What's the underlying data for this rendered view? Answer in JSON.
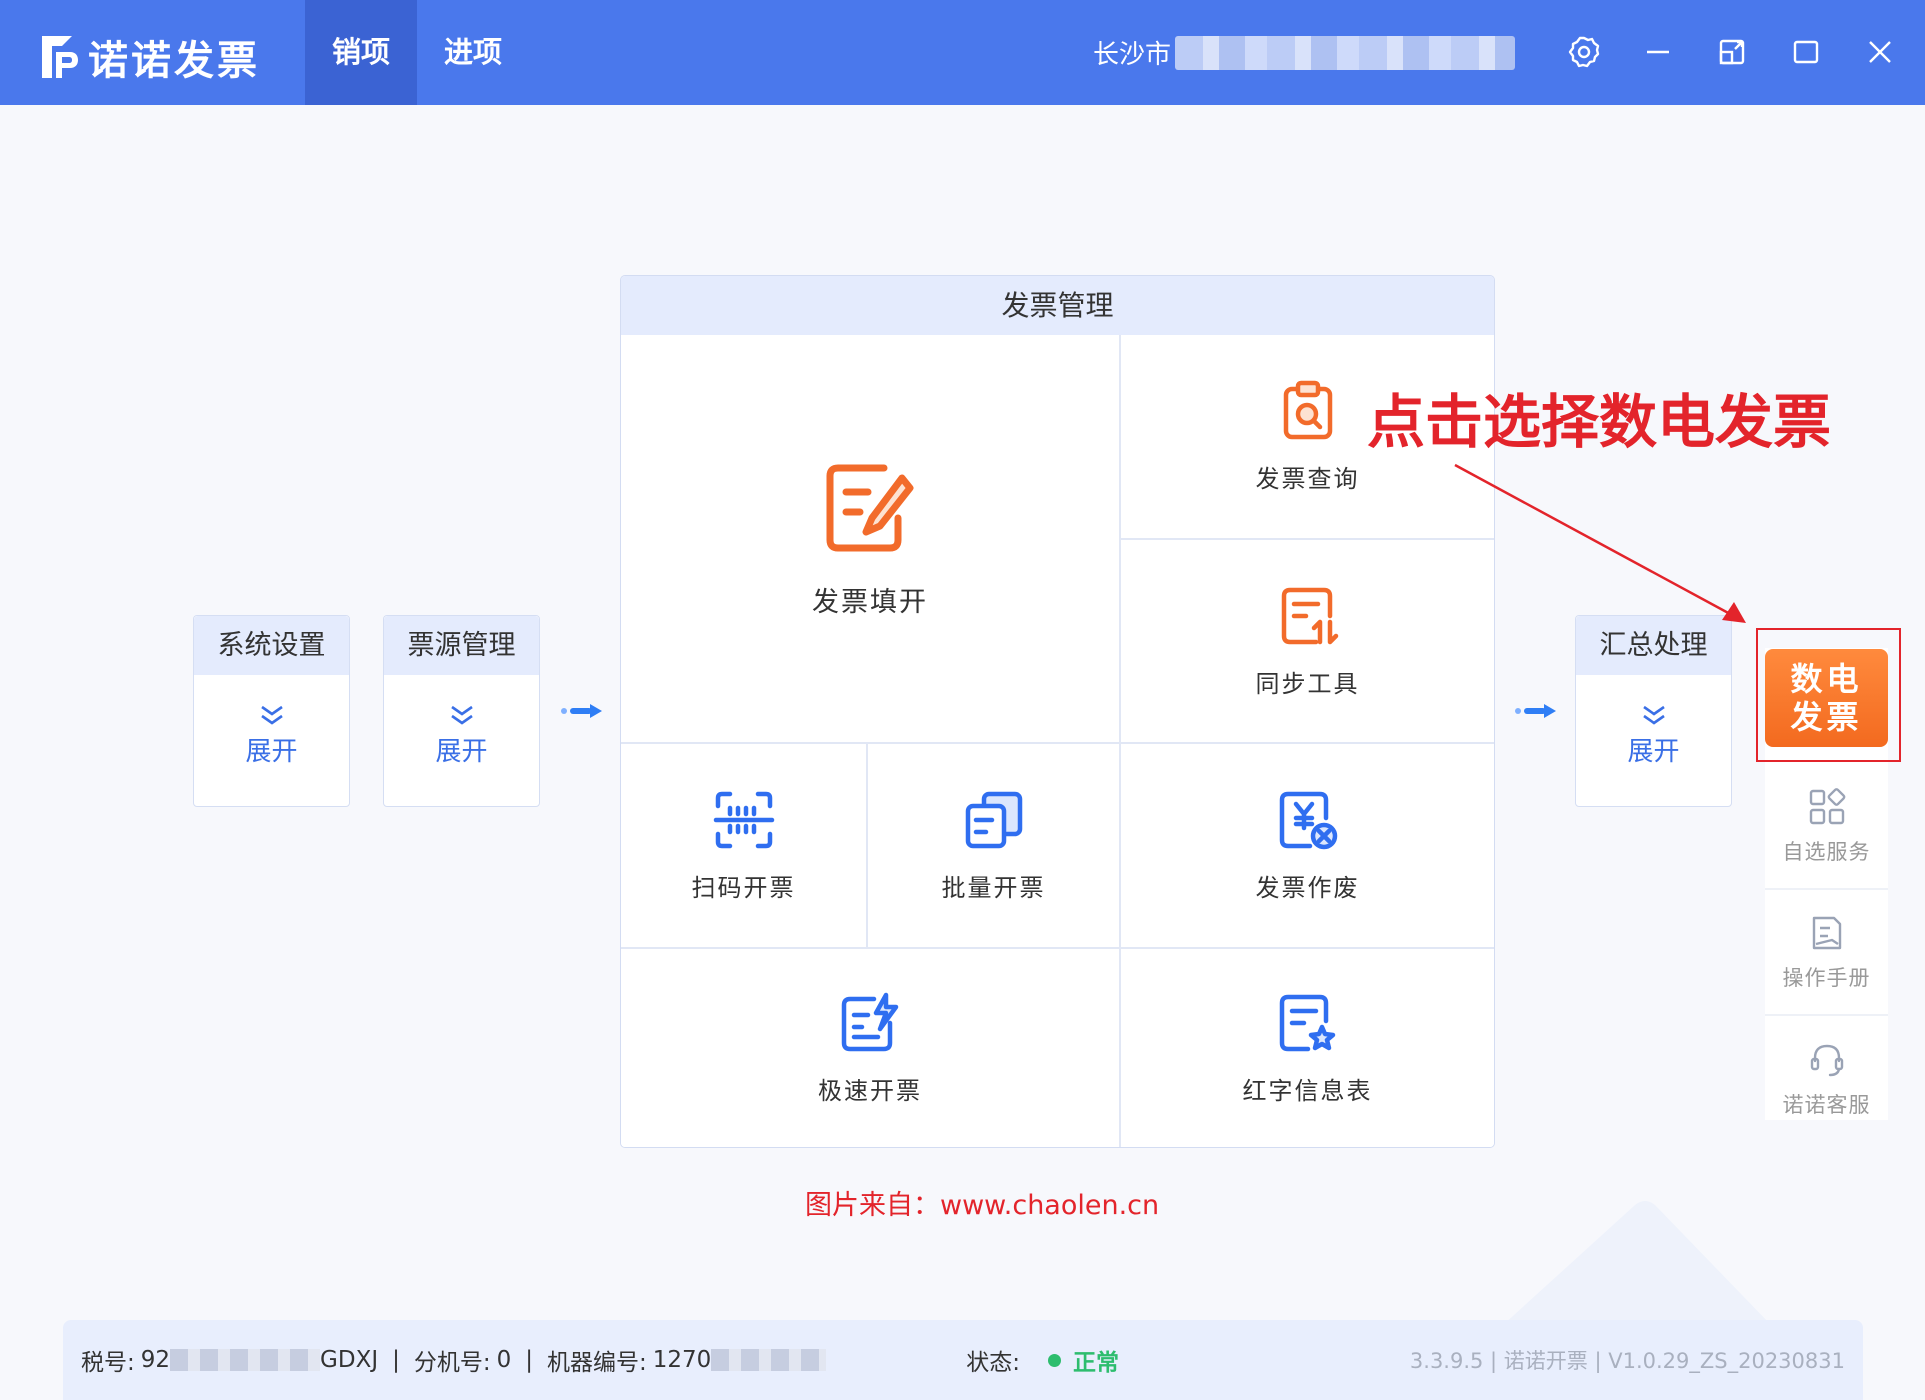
{
  "app": {
    "name": "诺诺发票",
    "tabs": [
      {
        "label": "销项",
        "active": true
      },
      {
        "label": "进项",
        "active": false
      }
    ],
    "company_prefix": "长沙市"
  },
  "window_controls": [
    "settings-icon",
    "minimize-icon",
    "restore-icon",
    "maximize-icon",
    "close-icon"
  ],
  "left_cards": [
    {
      "title": "系统设置",
      "action": "展开"
    },
    {
      "title": "票源管理",
      "action": "展开"
    }
  ],
  "right_card": {
    "title": "汇总处理",
    "action": "展开"
  },
  "panel": {
    "title": "发票管理",
    "items": [
      {
        "label": "发票填开",
        "icon": "edit-document-icon",
        "color": "#f26b2b"
      },
      {
        "label": "发票查询",
        "icon": "clipboard-search-icon",
        "color": "#f26b2b"
      },
      {
        "label": "同步工具",
        "icon": "sync-doc-icon",
        "color": "#f26b2b"
      },
      {
        "label": "扫码开票",
        "icon": "scan-icon",
        "color": "#2f6ef0"
      },
      {
        "label": "批量开票",
        "icon": "batch-copy-icon",
        "color": "#2f6ef0"
      },
      {
        "label": "发票作废",
        "icon": "void-invoice-icon",
        "color": "#2f6ef0"
      },
      {
        "label": "极速开票",
        "icon": "fast-invoice-icon",
        "color": "#2f6ef0"
      },
      {
        "label": "红字信息表",
        "icon": "red-letter-form-icon",
        "color": "#2f6ef0"
      }
    ]
  },
  "annotation": "点击选择数电发票",
  "credit": "图片来自：www.chaolen.cn",
  "sidebar": {
    "primary": "数电\n发票",
    "items": [
      {
        "label": "自选服务",
        "icon": "apps-icon"
      },
      {
        "label": "操作手册",
        "icon": "manual-icon"
      },
      {
        "label": "诺诺客服",
        "icon": "headset-icon"
      }
    ]
  },
  "status": {
    "tax_label": "税号:",
    "tax_prefix": "92",
    "tax_suffix": "GDXJ",
    "branch_label": "分机号:",
    "branch_value": "0",
    "machine_label": "机器编号:",
    "machine_prefix": "1270",
    "state_label": "状态:",
    "state_value": "正常",
    "version": "3.3.9.5 | 诺诺开票 | V1.0.29_ZS_20230831"
  },
  "colors": {
    "topbar": "#4a78ec",
    "accent_orange": "#f26b2b",
    "accent_blue": "#2f6ef0",
    "annotation_red": "#e3242b",
    "status_ok": "#2dbd6e"
  }
}
